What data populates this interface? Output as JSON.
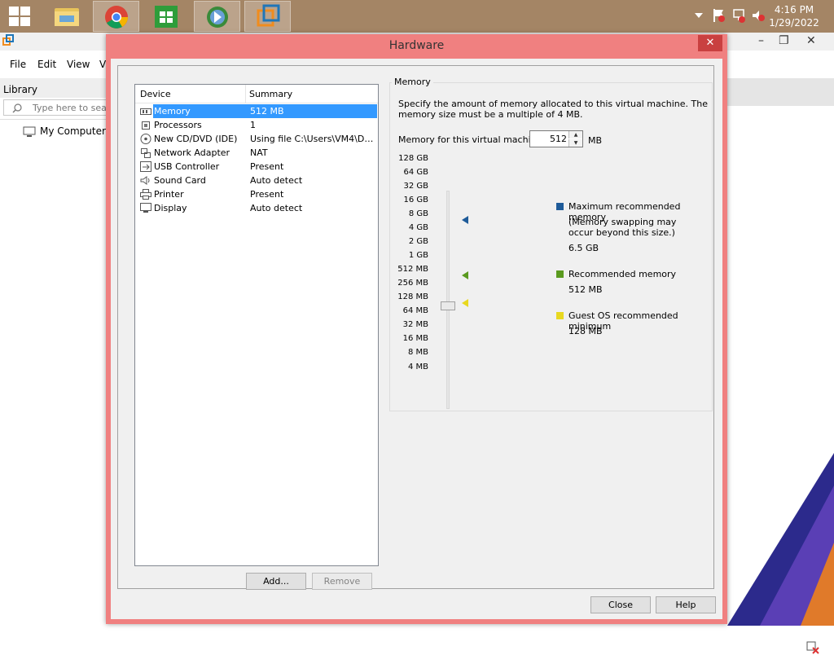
{
  "taskbar": {
    "clock": {
      "time": "4:16 PM",
      "date": "1/29/2022"
    },
    "apps": [
      "file-explorer",
      "chrome",
      "store",
      "download-manager",
      "vmware-workstation"
    ]
  },
  "bg_window": {
    "menus": [
      "File",
      "Edit",
      "View",
      "V"
    ],
    "library": {
      "title": "Library",
      "search_placeholder": "Type here to sear",
      "tree": [
        {
          "label": "My Computer"
        }
      ]
    }
  },
  "dialog": {
    "title": "Hardware",
    "close_glyph": "✕",
    "device_list": {
      "col_device": "Device",
      "col_summary": "Summary",
      "rows": [
        {
          "name": "Memory",
          "summary": "512 MB",
          "icon": "memory-icon",
          "selected": true
        },
        {
          "name": "Processors",
          "summary": "1",
          "icon": "processor-icon"
        },
        {
          "name": "New CD/DVD (IDE)",
          "summary": "Using file C:\\Users\\VM4\\Dow...",
          "icon": "cd-dvd-icon"
        },
        {
          "name": "Network Adapter",
          "summary": "NAT",
          "icon": "network-adapter-icon"
        },
        {
          "name": "USB Controller",
          "summary": "Present",
          "icon": "usb-icon"
        },
        {
          "name": "Sound Card",
          "summary": "Auto detect",
          "icon": "speaker-icon"
        },
        {
          "name": "Printer",
          "summary": "Present",
          "icon": "printer-icon"
        },
        {
          "name": "Display",
          "summary": "Auto detect",
          "icon": "display-icon"
        }
      ]
    },
    "buttons": {
      "add": "Add...",
      "remove": "Remove",
      "close": "Close",
      "help": "Help"
    },
    "memory": {
      "group_label": "Memory",
      "description": "Specify the amount of memory allocated to this virtual machine. The memory size must be a multiple of 4 MB.",
      "field_label": "Memory for this virtual machine:",
      "value": "512",
      "unit": "MB",
      "scale": [
        "128 GB",
        "64 GB",
        "32 GB",
        "16 GB",
        "8 GB",
        "4 GB",
        "2 GB",
        "1 GB",
        "512 MB",
        "256 MB",
        "128 MB",
        "64 MB",
        "32 MB",
        "16 MB",
        "8 MB",
        "4 MB"
      ],
      "slider_value": "512 MB",
      "legend": {
        "max": {
          "label": "Maximum recommended memory",
          "note_line1": "(Memory swapping may",
          "note_line2": "occur beyond this size.)",
          "value": "6.5 GB",
          "color": "#1e5b99"
        },
        "recommended": {
          "label": "Recommended memory",
          "value": "512 MB",
          "color": "#5a9a1f"
        },
        "guest_min": {
          "label": "Guest OS recommended minimum",
          "value": "128 MB",
          "color": "#e8d820"
        }
      }
    }
  },
  "colors": {
    "taskbar": "#a48565",
    "dialog_frame": "#f08080",
    "selection": "#3399ff"
  }
}
